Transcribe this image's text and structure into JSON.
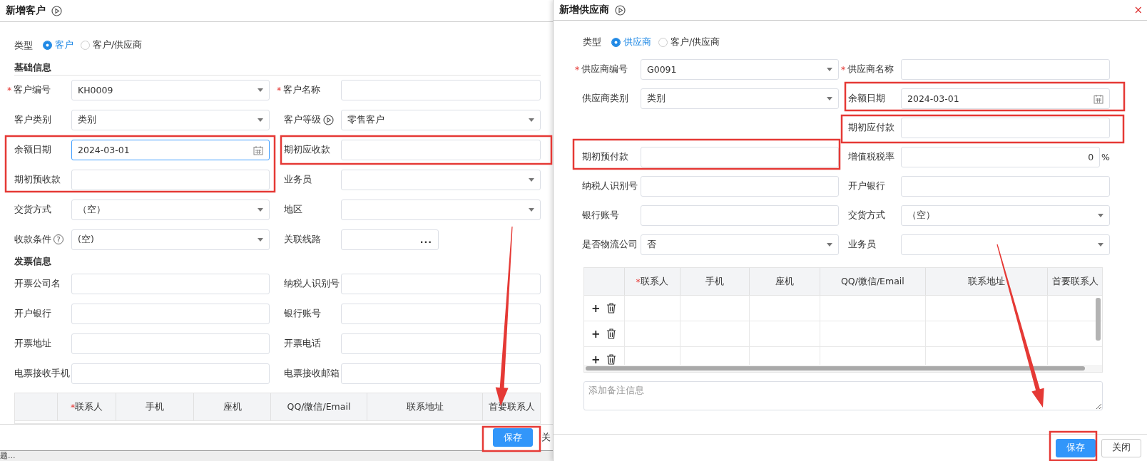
{
  "customer_dialog": {
    "title": "新增客户",
    "type": {
      "label": "类型",
      "options": [
        {
          "label": "客户",
          "selected": true
        },
        {
          "label": "客户/供应商",
          "selected": false
        }
      ]
    },
    "sections": [
      {
        "title": "基础信息",
        "rows": [
          {
            "left": {
              "label": "客户编号",
              "mark": "*",
              "kind": "select",
              "value": "KH0009"
            },
            "right": {
              "label": "客户名称",
              "mark": "*",
              "kind": "text"
            }
          },
          {
            "left": {
              "label": "客户类别",
              "kind": "select",
              "value": "类别"
            },
            "right": {
              "label": "客户等级",
              "has_hint": true,
              "kind": "select",
              "value": "零售客户"
            }
          },
          {
            "left": {
              "label": "余额日期",
              "kind": "date",
              "value": "2024-03-01",
              "focused": true
            },
            "right": {
              "label": "期初应收款",
              "kind": "text"
            }
          },
          {
            "left": {
              "label": "期初预收款",
              "kind": "text"
            },
            "right": {
              "label": "业务员",
              "kind": "select"
            }
          },
          {
            "left": {
              "label": "交货方式",
              "kind": "select",
              "value": "（空）"
            },
            "right": {
              "label": "地区",
              "kind": "select"
            }
          },
          {
            "left": {
              "label": "收款条件",
              "help": "?",
              "kind": "select",
              "value": "(空)"
            },
            "right": {
              "label": "关联线路",
              "kind": "picker",
              "button": "..."
            }
          }
        ]
      },
      {
        "title": "发票信息",
        "rows": [
          {
            "left": {
              "label": "开票公司名",
              "kind": "text"
            },
            "right": {
              "label": "纳税人识别号",
              "kind": "text"
            }
          },
          {
            "left": {
              "label": "开户银行",
              "kind": "text"
            },
            "right": {
              "label": "银行账号",
              "kind": "text"
            }
          },
          {
            "left": {
              "label": "开票地址",
              "kind": "text"
            },
            "right": {
              "label": "开票电话",
              "kind": "text"
            }
          },
          {
            "left": {
              "label": "电票接收手机",
              "kind": "text"
            },
            "right": {
              "label": "电票接收邮箱",
              "kind": "text"
            }
          }
        ]
      }
    ],
    "contacts": {
      "columns": [
        {
          "label": "联系人",
          "mark": "*"
        },
        {
          "label": "手机"
        },
        {
          "label": "座机"
        },
        {
          "label": "QQ/微信/Email"
        },
        {
          "label": "联系地址"
        },
        {
          "label": "首要联系人"
        }
      ]
    },
    "footer": {
      "buttons": [
        {
          "label": "保存",
          "kind": "primary"
        },
        {
          "label": "关",
          "kind": "plain"
        }
      ]
    }
  },
  "status_text": "题...",
  "supplier_dialog": {
    "title": "新增供应商",
    "close": "×",
    "type": {
      "label": "类型",
      "options": [
        {
          "label": "供应商",
          "selected": true
        },
        {
          "label": "客户/供应商",
          "selected": false
        }
      ]
    },
    "rows": [
      {
        "left": {
          "label": "供应商编号",
          "mark": "*",
          "kind": "select",
          "value": "G0091"
        },
        "right": {
          "label": "供应商名称",
          "mark": "*",
          "kind": "text"
        }
      },
      {
        "left": {
          "label": "供应商类别",
          "kind": "select",
          "value": "类别"
        },
        "right": {
          "label": "余额日期",
          "kind": "date",
          "value": "2024-03-01"
        }
      },
      {
        "right": {
          "label": "期初应付款",
          "kind": "text"
        }
      },
      {
        "left": {
          "label": "期初预付款",
          "kind": "text"
        },
        "right": {
          "label": "增值税税率",
          "kind": "percent",
          "value": "0",
          "suffix": "%"
        }
      },
      {
        "left": {
          "label": "纳税人识别号",
          "kind": "text"
        },
        "right": {
          "label": "开户银行",
          "kind": "text"
        }
      },
      {
        "left": {
          "label": "银行账号",
          "kind": "text"
        },
        "right": {
          "label": "交货方式",
          "kind": "select",
          "value": "（空）"
        }
      },
      {
        "left": {
          "label": "是否物流公司",
          "kind": "select",
          "value": "否"
        },
        "right": {
          "label": "业务员",
          "kind": "select"
        }
      }
    ],
    "contacts": {
      "columns": [
        {
          "label": "联系人",
          "mark": "*"
        },
        {
          "label": "手机"
        },
        {
          "label": "座机"
        },
        {
          "label": "QQ/微信/Email"
        },
        {
          "label": "联系地址"
        },
        {
          "label": "首要联系人"
        }
      ],
      "rows": [
        {
          "add": "+"
        },
        {
          "add": "+"
        },
        {
          "add": "+"
        }
      ]
    },
    "remark": {
      "placeholder": "添加备注信息"
    },
    "footer": {
      "buttons": [
        {
          "label": "保存",
          "kind": "primary"
        },
        {
          "label": "关闭",
          "kind": "plain"
        }
      ]
    }
  }
}
